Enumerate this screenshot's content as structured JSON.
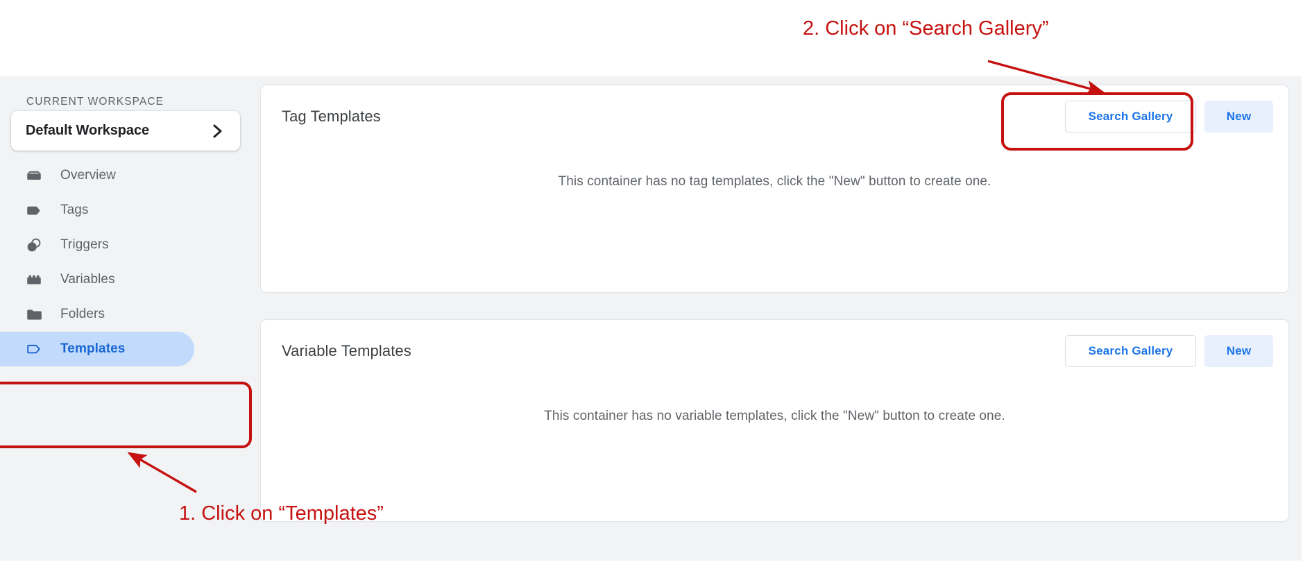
{
  "sidebar": {
    "workspace_label": "CURRENT WORKSPACE",
    "workspace_name": "Default Workspace",
    "chevron_icon": "chevron-right-icon",
    "items": [
      {
        "label": "Overview",
        "icon": "overview-box-icon",
        "active": false
      },
      {
        "label": "Tags",
        "icon": "tag-filled-icon",
        "active": false
      },
      {
        "label": "Triggers",
        "icon": "triggers-circles-icon",
        "active": false
      },
      {
        "label": "Variables",
        "icon": "variables-brick-icon",
        "active": false
      },
      {
        "label": "Folders",
        "icon": "folder-filled-icon",
        "active": false
      },
      {
        "label": "Templates",
        "icon": "tag-outline-icon",
        "active": true
      }
    ]
  },
  "cards": [
    {
      "title": "Tag Templates",
      "search_label": "Search Gallery",
      "new_label": "New",
      "empty_message": "This container has no tag templates, click the \"New\" button to create one."
    },
    {
      "title": "Variable Templates",
      "search_label": "Search Gallery",
      "new_label": "New",
      "empty_message": "This container has no variable templates, click the \"New\" button to create one."
    }
  ],
  "annotations": {
    "step1": "1. Click on “Templates”",
    "step2": "2. Click on “Search Gallery”",
    "highlight_color": "#c5110f"
  },
  "colors": {
    "accent_blue": "#1a73e8",
    "active_nav_bg": "#c2dbfc",
    "active_nav_text": "#1967d2",
    "tonal_button_bg": "#e8f0fe",
    "app_bg": "#f1f3f4",
    "card_bg": "#ffffff",
    "text_primary": "#3c4043",
    "text_secondary": "#5f6368",
    "annotation_red": "#c5110f"
  }
}
